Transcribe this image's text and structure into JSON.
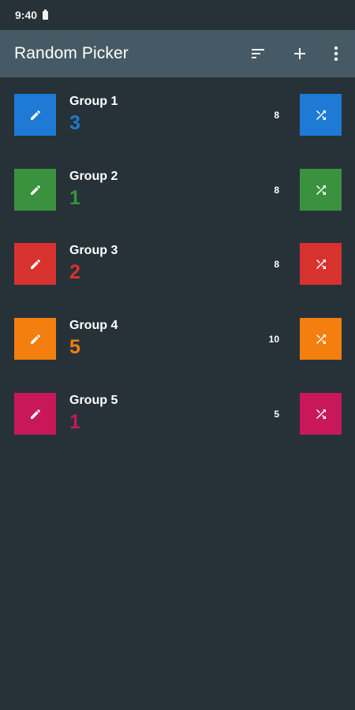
{
  "status_bar": {
    "time": "9:40"
  },
  "app_bar": {
    "title": "Random Picker",
    "actions": [
      {
        "icon": "sort-icon"
      },
      {
        "icon": "add-icon"
      },
      {
        "icon": "more-vert-icon"
      }
    ]
  },
  "colors": {
    "background": "#263238",
    "app_bar": "#455a64"
  },
  "groups": [
    {
      "name": "Group 1",
      "value": "3",
      "count": "8",
      "color": "#1e7ad4"
    },
    {
      "name": "Group 2",
      "value": "1",
      "count": "8",
      "color": "#3a923e"
    },
    {
      "name": "Group 3",
      "value": "2",
      "count": "8",
      "color": "#d8322f"
    },
    {
      "name": "Group 4",
      "value": "5",
      "count": "10",
      "color": "#f57f0e"
    },
    {
      "name": "Group 5",
      "value": "1",
      "count": "5",
      "color": "#c8185a"
    }
  ]
}
